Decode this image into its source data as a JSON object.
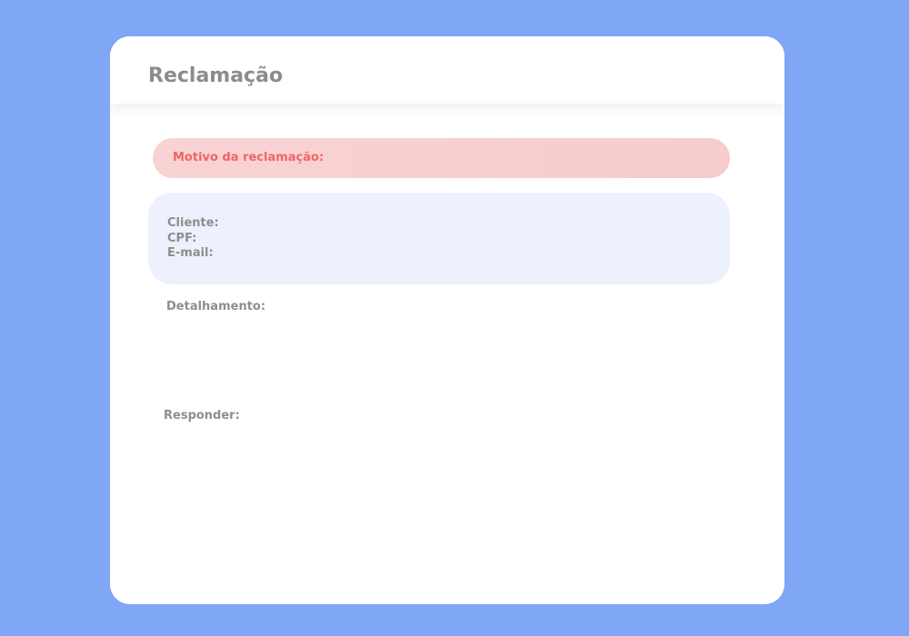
{
  "page": {
    "title": "Reclamação"
  },
  "reason": {
    "label": "Motivo da reclamação:"
  },
  "client": {
    "name_label": "Cliente:",
    "cpf_label": "CPF:",
    "email_label": "E-mail:"
  },
  "detail": {
    "label": "Detalhamento:"
  },
  "response": {
    "label": "Responder:"
  },
  "colors": {
    "background": "#80a6f6",
    "card": "#ffffff",
    "reason_banner": "#f8d3d3",
    "reason_text": "#f06565",
    "client_panel": "#edf1fd",
    "text_gray": "#8e8e8e"
  }
}
